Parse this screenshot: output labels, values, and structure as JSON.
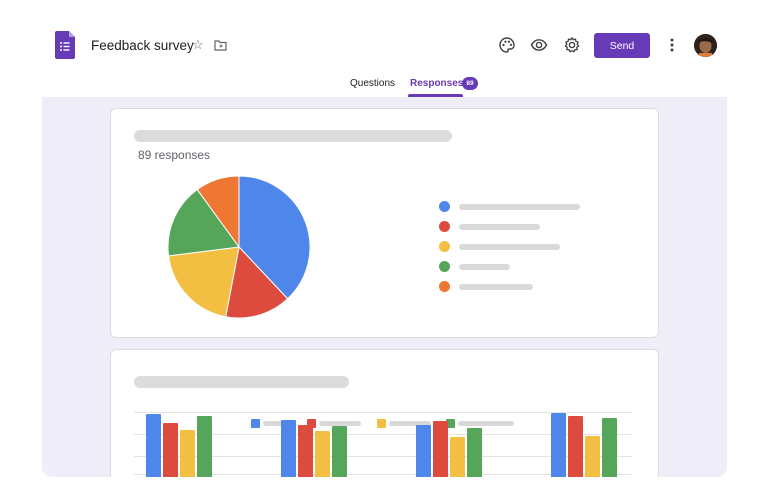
{
  "header": {
    "title": "Feedback survey",
    "send_label": "Send",
    "tabs": [
      {
        "label": "Questions",
        "active": false
      },
      {
        "label": "Responses",
        "active": true,
        "badge": "89"
      }
    ]
  },
  "summary": {
    "response_count": "89 responses"
  },
  "colors": {
    "brand": "#673ab7",
    "blue": "#4f86e9",
    "red": "#dc4b3e",
    "yellow": "#f2bf42",
    "green": "#55a55b",
    "orange": "#ee7733"
  },
  "pie_chart": {
    "slices": [
      {
        "color": "blue",
        "value": 0.38
      },
      {
        "color": "red",
        "value": 0.15
      },
      {
        "color": "yellow",
        "value": 0.2
      },
      {
        "color": "green",
        "value": 0.17
      },
      {
        "color": "orange",
        "value": 0.1
      }
    ]
  },
  "bar_chart": {
    "series": [
      {
        "color": "blue",
        "values": [
          32,
          26,
          21,
          33
        ]
      },
      {
        "color": "red",
        "values": [
          23,
          21,
          25,
          30
        ]
      },
      {
        "color": "yellow",
        "values": [
          16,
          15,
          9,
          10
        ]
      },
      {
        "color": "green",
        "values": [
          30,
          20,
          18,
          28
        ]
      }
    ]
  },
  "icons": [
    "forms-app-icon",
    "star-icon",
    "folder-icon",
    "palette-icon",
    "eye-icon",
    "gear-icon",
    "more-vert-icon"
  ]
}
